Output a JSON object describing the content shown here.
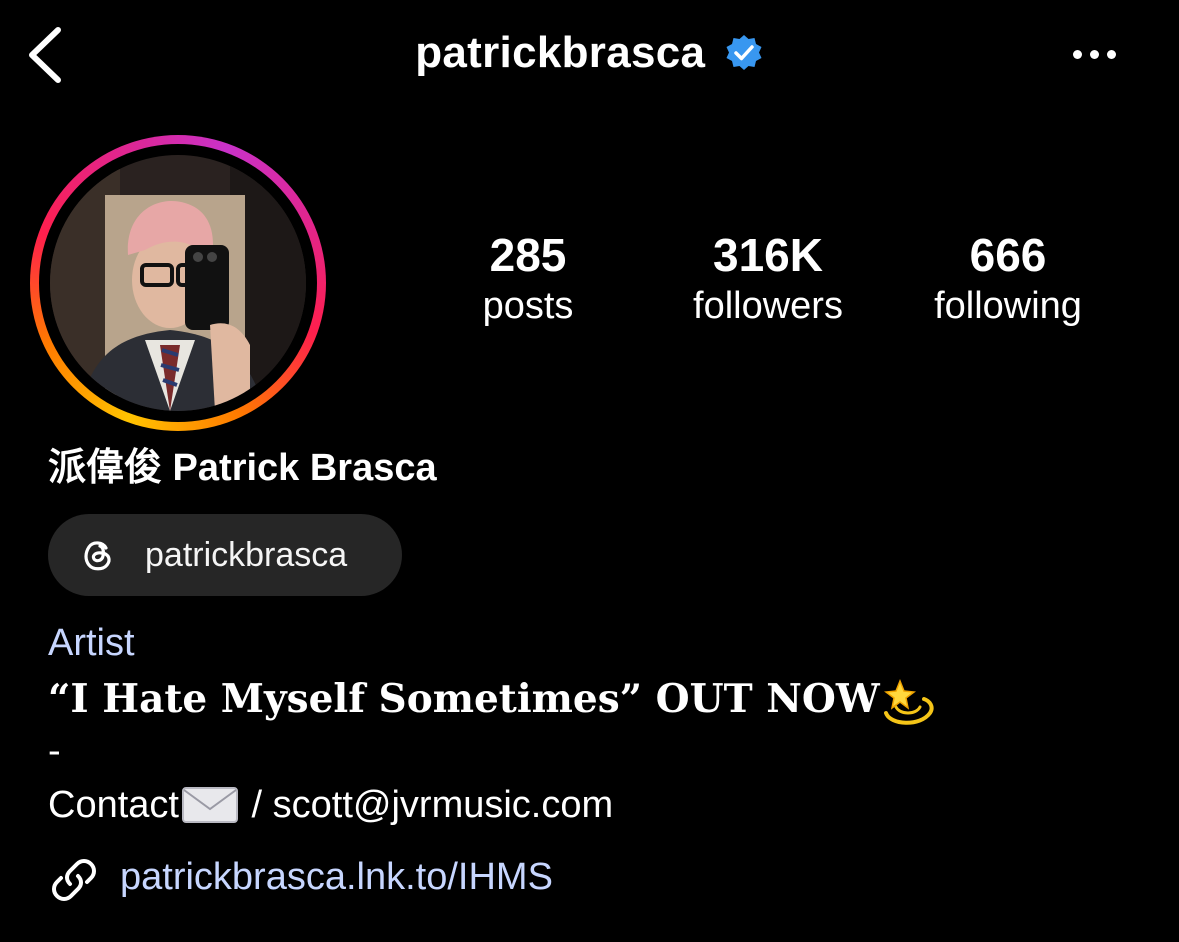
{
  "header": {
    "username": "patrickbrasca",
    "verified": true,
    "icons": {
      "back": "chevron-left-icon",
      "more": "more-horizontal-icon",
      "verified": "verified-badge-icon"
    }
  },
  "profile": {
    "avatar_alt": "profile photo",
    "stats": [
      {
        "value": "285",
        "label": "posts"
      },
      {
        "value": "316K",
        "label": "followers"
      },
      {
        "value": "666",
        "label": "following"
      }
    ],
    "display_name": "派偉俊 Patrick Brasca",
    "threads": {
      "handle": "patrickbrasca",
      "icon": "threads-icon"
    },
    "category": "Artist",
    "bio": {
      "line1": "“I Hate Myself Sometimes” OUT NOW",
      "line1_emoji": "dizzy-star-emoji",
      "line2": "-",
      "contact_prefix": "Contact",
      "contact_emoji": "envelope-emoji",
      "contact_suffix": " / scott@jvrmusic.com"
    },
    "link": {
      "text": "patrickbrasca.lnk.to/IHMS",
      "icon": "link-icon"
    }
  },
  "colors": {
    "background": "#000000",
    "text": "#ffffff",
    "link": "#c7d6ff",
    "pill": "#262626",
    "verified_blue": "#3897f0"
  }
}
